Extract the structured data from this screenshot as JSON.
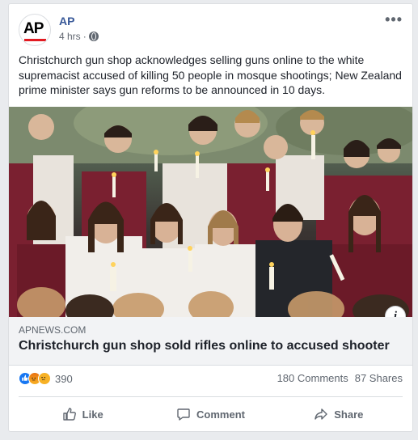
{
  "post": {
    "page_name": "AP",
    "avatar_text": "AP",
    "time": "4 hrs",
    "separator": "·",
    "privacy_icon": "globe-icon",
    "more_icon": "more-horizontal-icon",
    "text": "Christchurch gun shop acknowledges selling guns online to the white supremacist accused of killing 50 people in mosque shootings; New Zealand prime minister says gun reforms to be announced in 10 days."
  },
  "link": {
    "domain": "APNEWS.COM",
    "title": "Christchurch gun shop sold rifles online to accused shooter",
    "info_icon": "info-icon",
    "info_label": "i"
  },
  "stats": {
    "reaction_icons": [
      "like-icon",
      "angry-icon",
      "sad-icon"
    ],
    "reaction_count": "390",
    "comments": "180 Comments",
    "shares": "87 Shares"
  },
  "actions": {
    "like_label": "Like",
    "comment_label": "Comment",
    "share_label": "Share"
  },
  "colors": {
    "link_blue": "#385898",
    "ap_red": "#e21b22",
    "like_blue": "#1877f2",
    "reaction_yellow": "#f7b125",
    "secondary_text": "#606770"
  }
}
